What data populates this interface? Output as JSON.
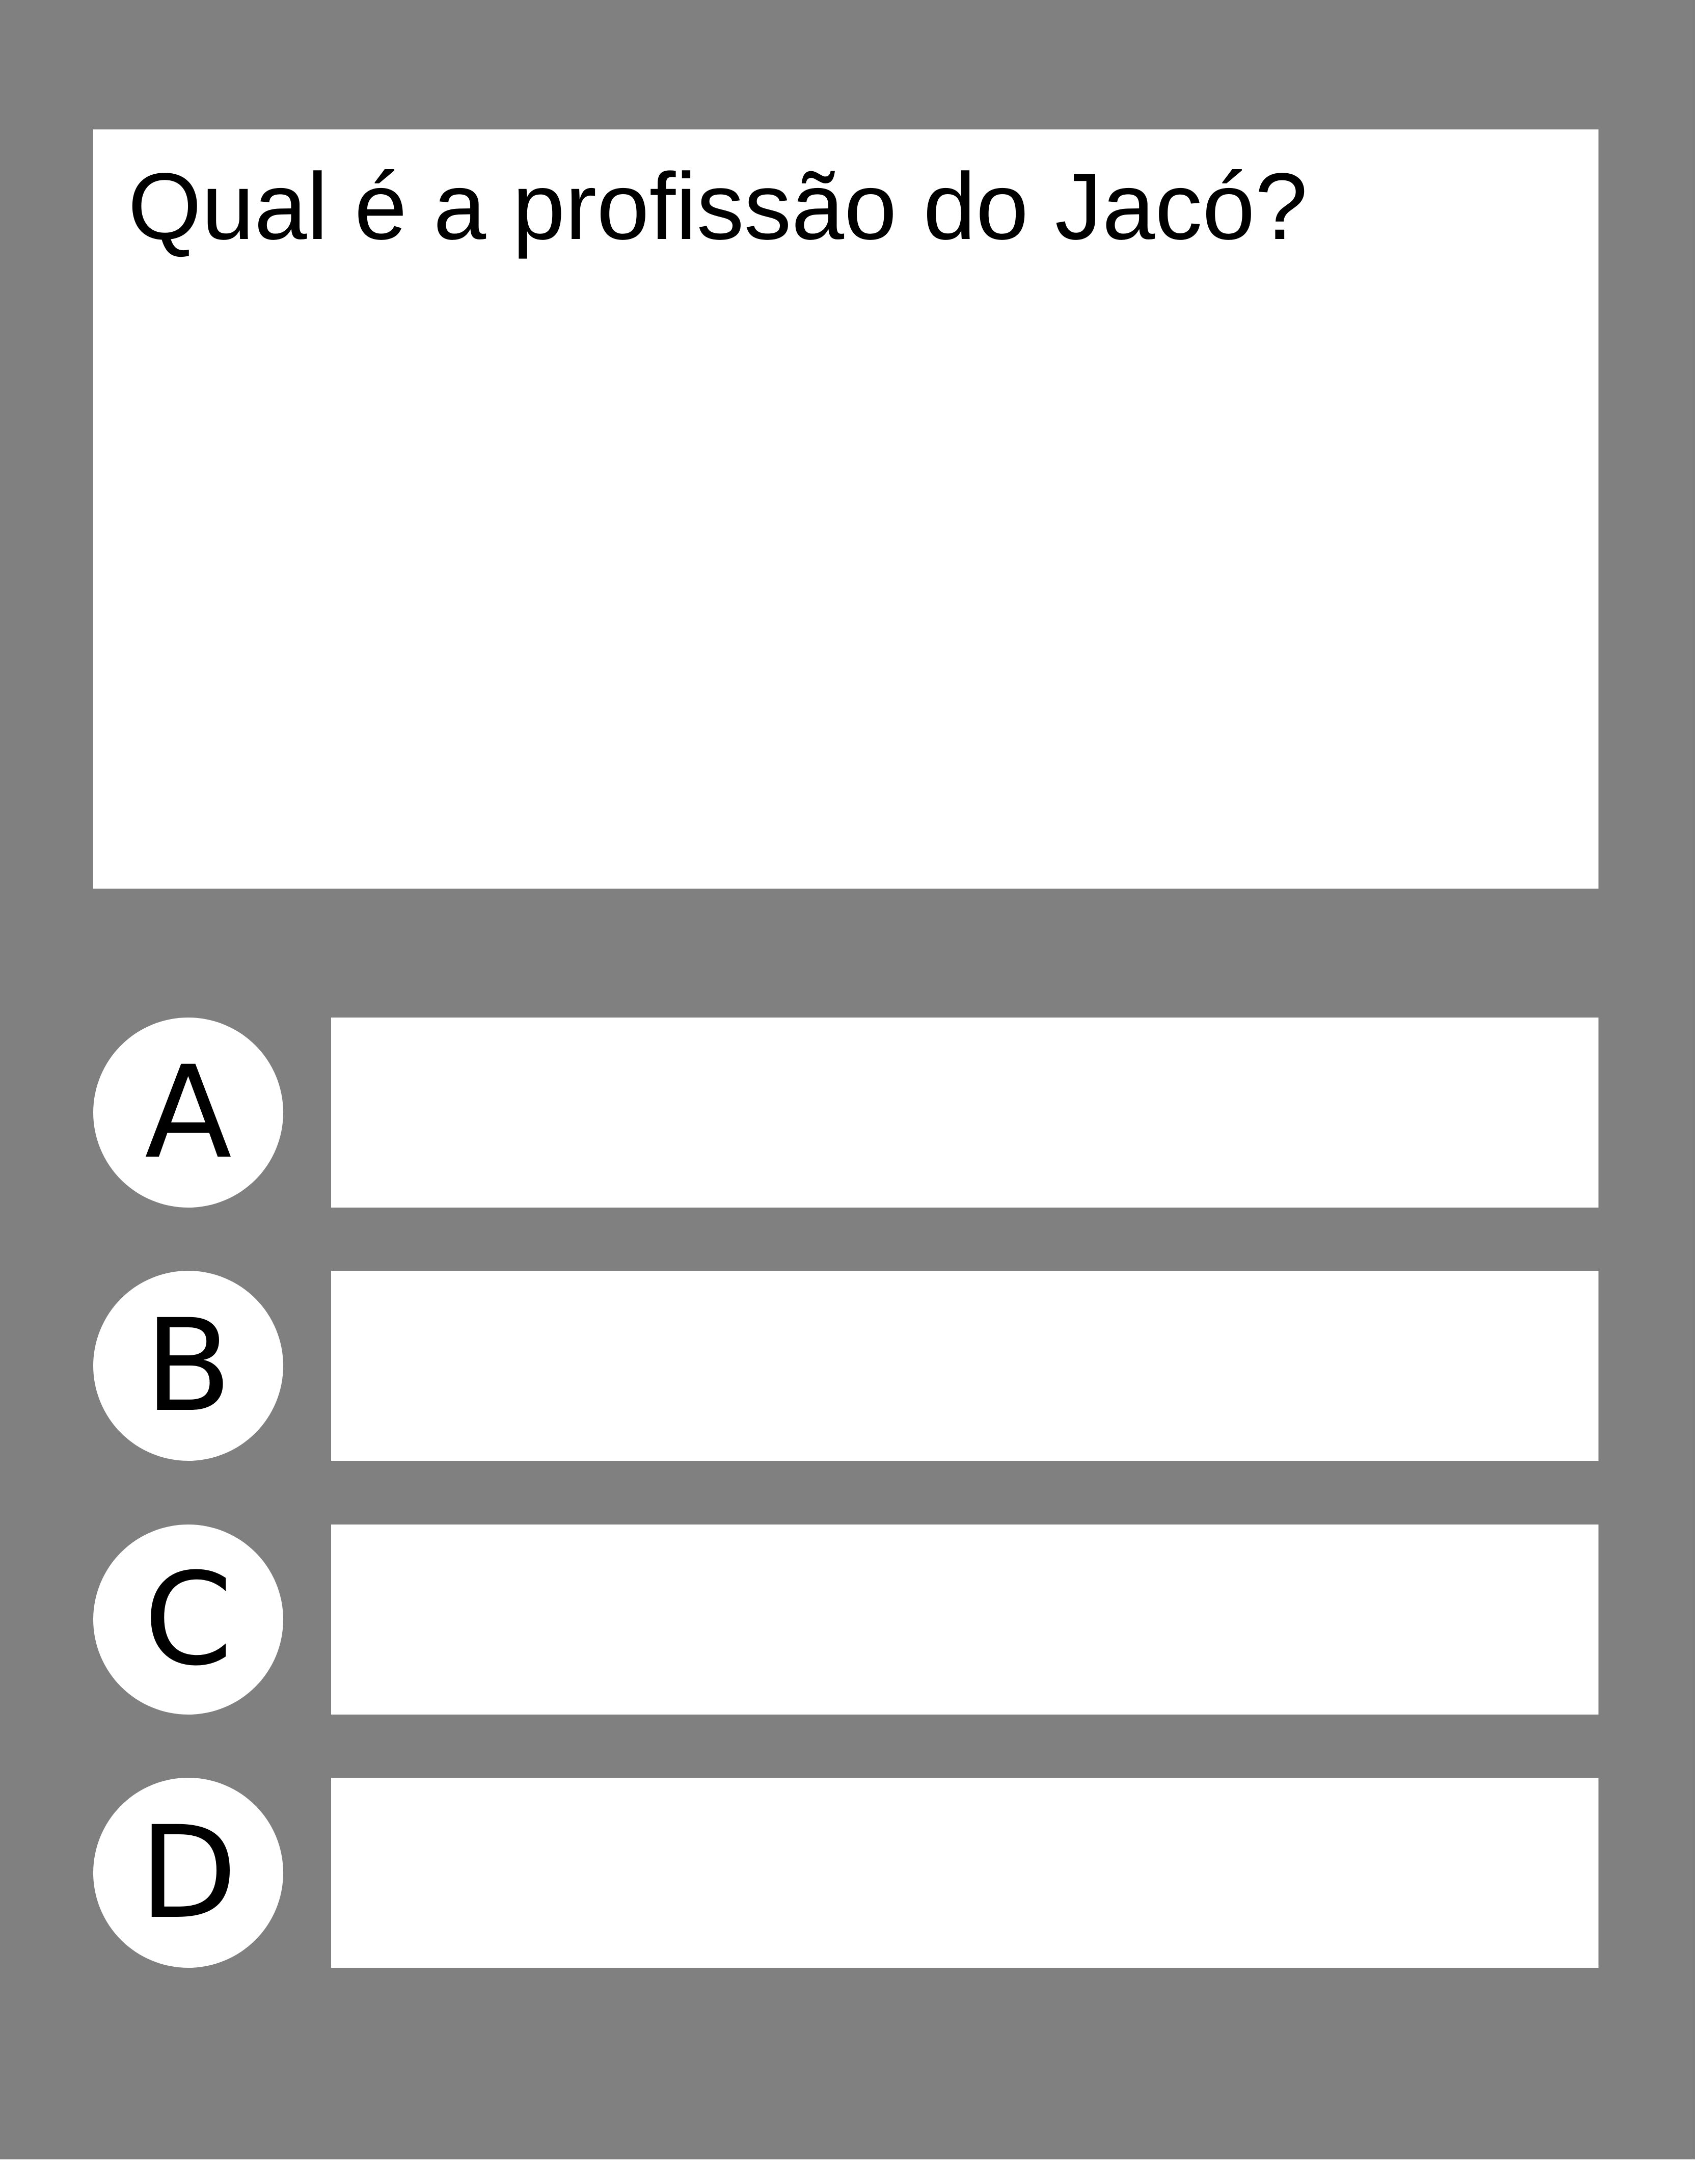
{
  "question": {
    "text": "Qual é a profissão do Jacó?"
  },
  "options": [
    {
      "letter": "A",
      "text": ""
    },
    {
      "letter": "B",
      "text": ""
    },
    {
      "letter": "C",
      "text": ""
    },
    {
      "letter": "D",
      "text": ""
    }
  ],
  "colors": {
    "background": "#808080",
    "panel": "#ffffff",
    "text": "#000000"
  }
}
